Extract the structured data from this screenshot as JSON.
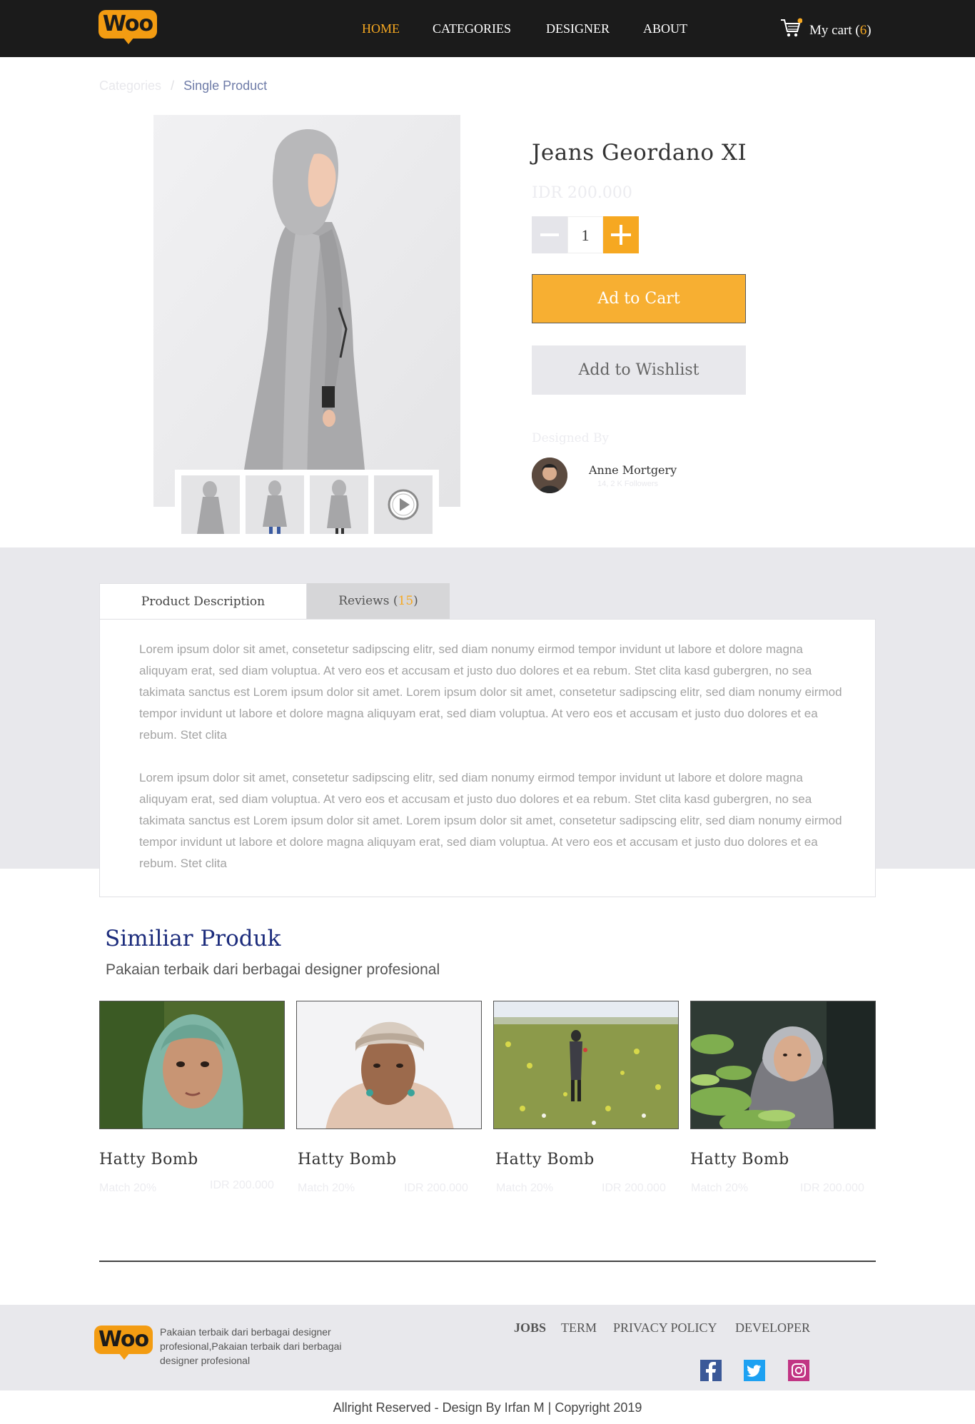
{
  "brand": {
    "logo_text": "Woo",
    "accent": "#f6a821"
  },
  "nav": {
    "items": [
      {
        "label": "HOME",
        "active": true
      },
      {
        "label": "CATEGORIES",
        "active": false
      },
      {
        "label": "DESIGNER",
        "active": false
      },
      {
        "label": "ABOUT",
        "active": false
      }
    ],
    "cart_label": "My cart",
    "cart_open": "(",
    "cart_count": "6",
    "cart_close": ")"
  },
  "breadcrumb": {
    "items": [
      "Categories",
      "Single Product"
    ],
    "separator": "/"
  },
  "product": {
    "title": "Jeans Geordano XI",
    "price": "IDR 200.000",
    "quantity": "1",
    "add_to_cart": "Ad to Cart",
    "add_to_wishlist": "Add to Wishlist",
    "designed_by_label": "Designed By",
    "designer_name": "Anne Mortgery",
    "designer_followers": "14, 2 K Followers"
  },
  "tabs": {
    "description_label": "Product Description",
    "reviews_label": "Reviews",
    "reviews_open": "(",
    "reviews_count": "15",
    "reviews_close": ")"
  },
  "description": {
    "paragraphs": [
      "Lorem ipsum dolor sit amet, consetetur sadipscing elitr, sed diam nonumy eirmod tempor invidunt ut labore et dolore magna aliquyam erat, sed diam voluptua. At vero eos et accusam et justo duo dolores et ea rebum. Stet clita kasd gubergren, no sea takimata sanctus est Lorem ipsum dolor sit amet. Lorem ipsum dolor sit amet, consetetur sadipscing elitr, sed diam nonumy eirmod tempor invidunt ut labore et dolore magna aliquyam erat, sed diam voluptua. At vero eos et accusam et justo duo dolores et ea rebum. Stet clita",
      "Lorem ipsum dolor sit amet, consetetur sadipscing elitr, sed diam nonumy eirmod tempor invidunt ut labore et dolore magna aliquyam erat, sed diam voluptua. At vero eos et accusam et justo duo dolores et ea rebum. Stet clita kasd gubergren, no sea takimata sanctus est Lorem ipsum dolor sit amet. Lorem ipsum dolor sit amet, consetetur sadipscing elitr, sed diam nonumy eirmod tempor invidunt ut labore et dolore magna aliquyam erat, sed diam voluptua. At vero eos et accusam et justo duo dolores et ea rebum. Stet clita"
    ]
  },
  "similar": {
    "title": "Similiar Produk",
    "subtitle": "Pakaian terbaik dari berbagai designer profesional",
    "products": [
      {
        "name": "Hatty Bomb",
        "match": "Match 20%",
        "price": "IDR 200.000"
      },
      {
        "name": "Hatty Bomb",
        "match": "Match 20%",
        "price": "IDR 200.000"
      },
      {
        "name": "Hatty Bomb",
        "match": "Match 20%",
        "price": "IDR 200.000"
      },
      {
        "name": "Hatty Bomb",
        "match": "Match 20%",
        "price": "IDR 200.000"
      }
    ]
  },
  "footer": {
    "tagline": "Pakaian terbaik dari berbagai designer profesional,Pakaian terbaik dari berbagai designer profesional",
    "links": [
      "JOBS",
      "TERM",
      "PRIVACY POLICY",
      "DEVELOPER"
    ],
    "social": [
      "facebook-icon",
      "twitter-icon",
      "instagram-icon"
    ],
    "copyright": "Allright Reserved - Design By Irfan M | Copyright 2019"
  }
}
